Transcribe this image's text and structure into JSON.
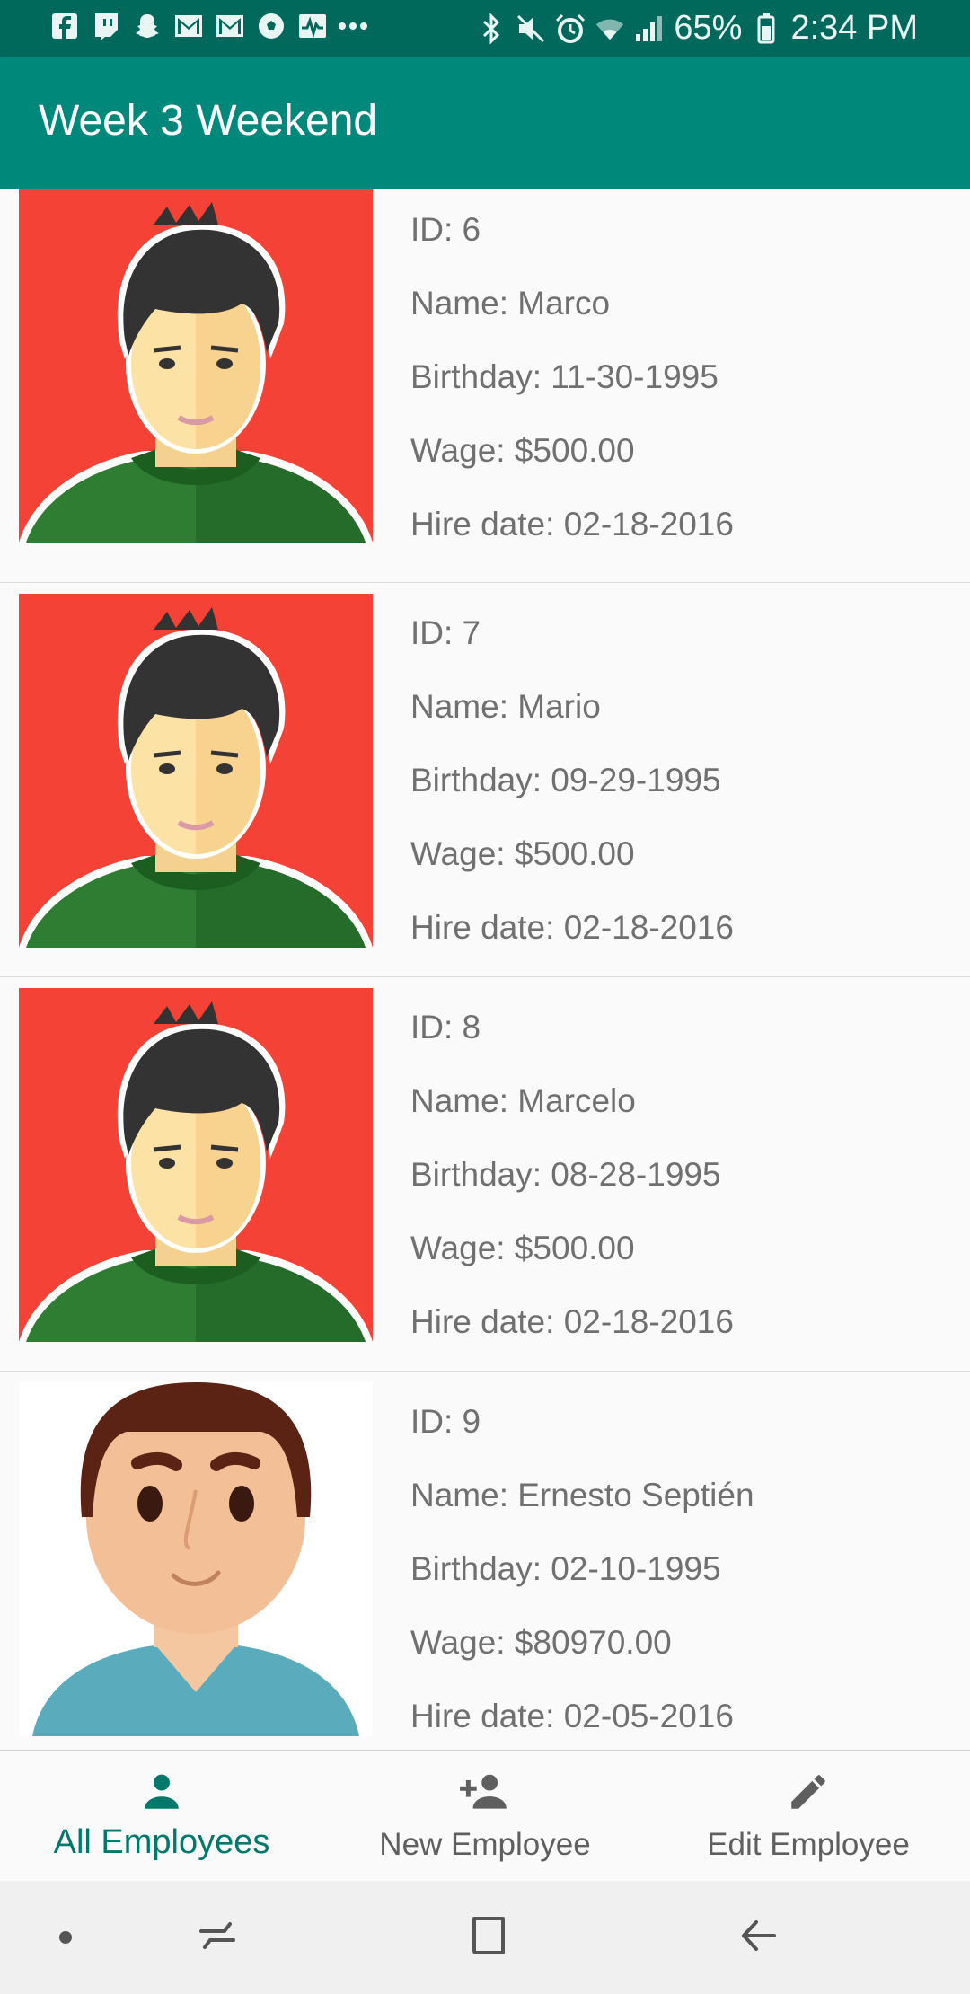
{
  "status_bar": {
    "left_icons": [
      "facebook-icon",
      "twitch-icon",
      "snapchat-icon",
      "gmail-icon",
      "gmail-icon",
      "soccer-ball-icon",
      "activity-icon",
      "more-notifications-icon"
    ],
    "right_icons": [
      "bluetooth-icon",
      "mute-icon",
      "alarm-icon",
      "wifi-icon",
      "signal-icon"
    ],
    "battery": "65%",
    "time": "2:34 PM"
  },
  "app_bar": {
    "title": "Week 3 Weekend",
    "color": "#00897b"
  },
  "employees": [
    {
      "id": "ID: 6",
      "name": "Name: Marco",
      "birthday": "Birthday: 11-30-1995",
      "wage": "Wage: $500.00",
      "hire_date": "Hire date: 02-18-2016",
      "avatar": "cartoon-man-red-background"
    },
    {
      "id": "ID: 7",
      "name": "Name: Mario",
      "birthday": "Birthday: 09-29-1995",
      "wage": "Wage: $500.00",
      "hire_date": "Hire date: 02-18-2016",
      "avatar": "cartoon-man-red-background"
    },
    {
      "id": "ID: 8",
      "name": "Name: Marcelo",
      "birthday": "Birthday: 08-28-1995",
      "wage": "Wage: $500.00",
      "hire_date": "Hire date: 02-18-2016",
      "avatar": "cartoon-man-red-background"
    },
    {
      "id": "ID: 9",
      "name": "Name: Ernesto Septién",
      "birthday": "Birthday: 02-10-1995",
      "wage": "Wage: $80970.00",
      "hire_date": "Hire date: 02-05-2016",
      "avatar": "cartoon-man-white-background"
    }
  ],
  "bottom_nav": {
    "items": [
      {
        "label": "All Employees",
        "icon": "person-icon",
        "active": true
      },
      {
        "label": "New Employee",
        "icon": "person-add-icon",
        "active": false
      },
      {
        "label": "Edit Employee",
        "icon": "pencil-icon",
        "active": false
      }
    ],
    "active_color": "#00796b"
  },
  "system_nav": [
    "dot-icon",
    "recent-apps-icon",
    "home-icon",
    "back-icon"
  ]
}
